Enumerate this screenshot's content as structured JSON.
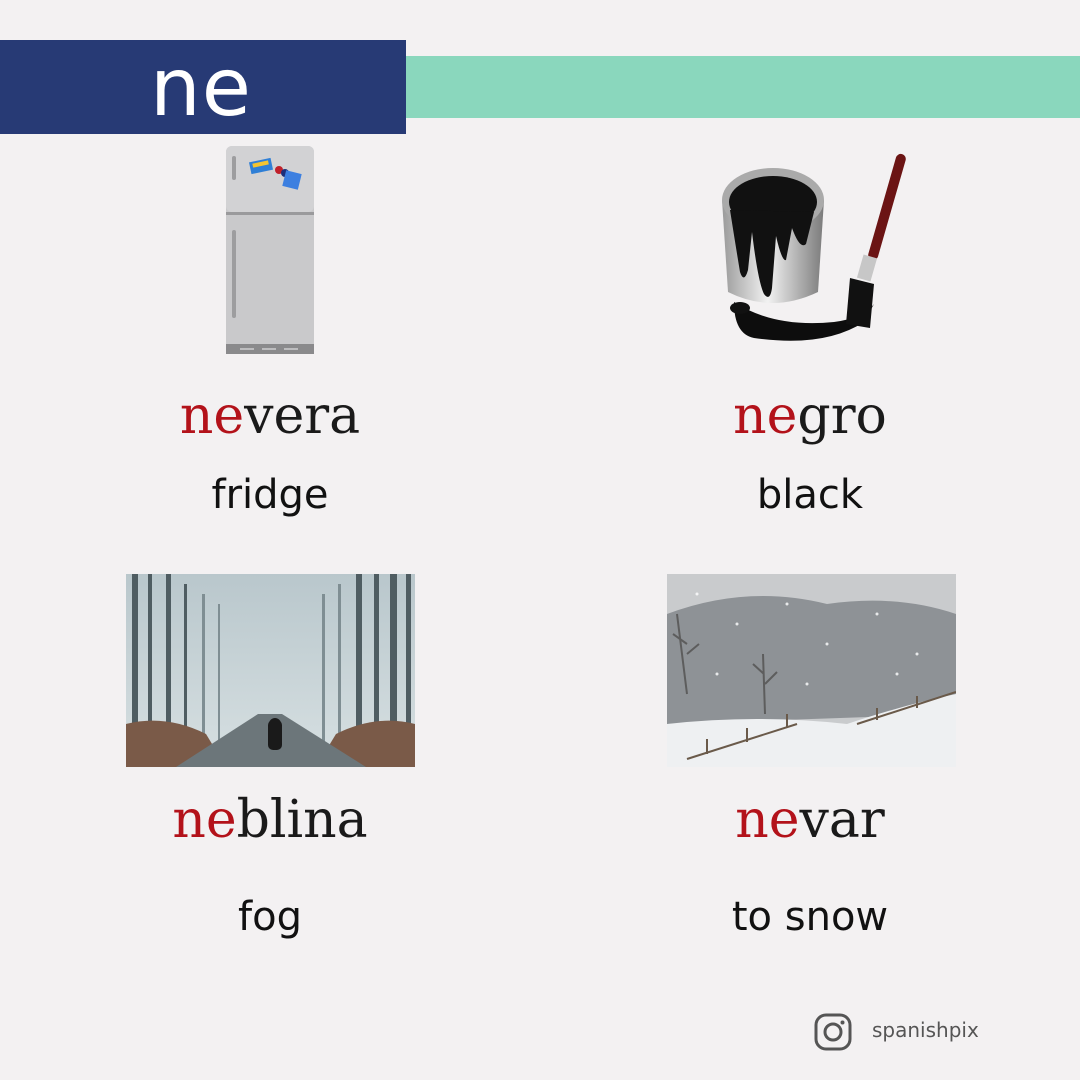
{
  "header": {
    "syllable": "ne"
  },
  "cards": [
    {
      "prefix": "ne",
      "rest": "vera",
      "translation": "fridge",
      "image": "fridge-icon"
    },
    {
      "prefix": "ne",
      "rest": "gro",
      "translation": "black",
      "image": "paint-can-brush-icon"
    },
    {
      "prefix": "ne",
      "rest": "blina",
      "translation": "fog",
      "image": "foggy-forest-road-photo"
    },
    {
      "prefix": "ne",
      "rest": "var",
      "translation": "to snow",
      "image": "snowfall-landscape-photo"
    }
  ],
  "footer": {
    "handle": "spanishpix",
    "icon": "instagram-icon"
  },
  "colors": {
    "navy": "#273a75",
    "mint": "#8ad7bd",
    "highlight": "#b3121a",
    "background": "#f3f1f2"
  }
}
